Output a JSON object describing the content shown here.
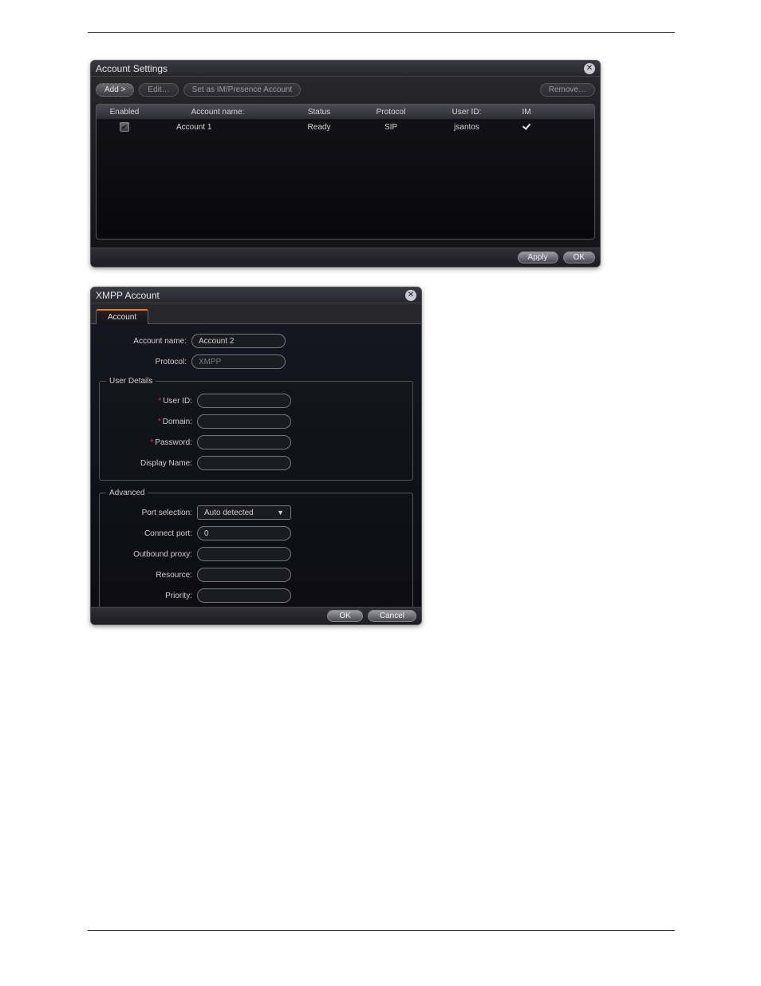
{
  "settings": {
    "title": "Account Settings",
    "toolbar": {
      "add": "Add >",
      "edit": "Edit…",
      "setim": "Set as IM/Presence Account",
      "remove": "Remove…"
    },
    "columns": {
      "enabled": "Enabled",
      "name": "Account name:",
      "status": "Status",
      "protocol": "Protocol",
      "userid": "User ID:",
      "im": "IM"
    },
    "rows": [
      {
        "enabled": true,
        "name": "Account 1",
        "status": "Ready",
        "protocol": "SIP",
        "userid": "jsantos",
        "im": true
      }
    ],
    "footer": {
      "apply": "Apply",
      "ok": "OK"
    }
  },
  "xmpp": {
    "title": "XMPP Account",
    "tab": "Account",
    "form": {
      "account_name_label": "Account name:",
      "account_name_value": "Account 2",
      "protocol_label": "Protocol:",
      "protocol_value": "XMPP"
    },
    "userdetails": {
      "legend": "User Details",
      "userid_label": "User ID:",
      "userid_value": "",
      "domain_label": "Domain:",
      "domain_value": "",
      "password_label": "Password:",
      "password_value": "",
      "display_label": "Display Name:",
      "display_value": ""
    },
    "advanced": {
      "legend": "Advanced",
      "port_sel_label": "Port selection:",
      "port_sel_value": "Auto detected",
      "connect_port_label": "Connect port:",
      "connect_port_value": "0",
      "outbound_label": "Outbound proxy:",
      "outbound_value": "",
      "resource_label": "Resource:",
      "resource_value": "",
      "priority_label": "Priority:",
      "priority_value": ""
    },
    "footer": {
      "ok": "OK",
      "cancel": "Cancel"
    }
  }
}
